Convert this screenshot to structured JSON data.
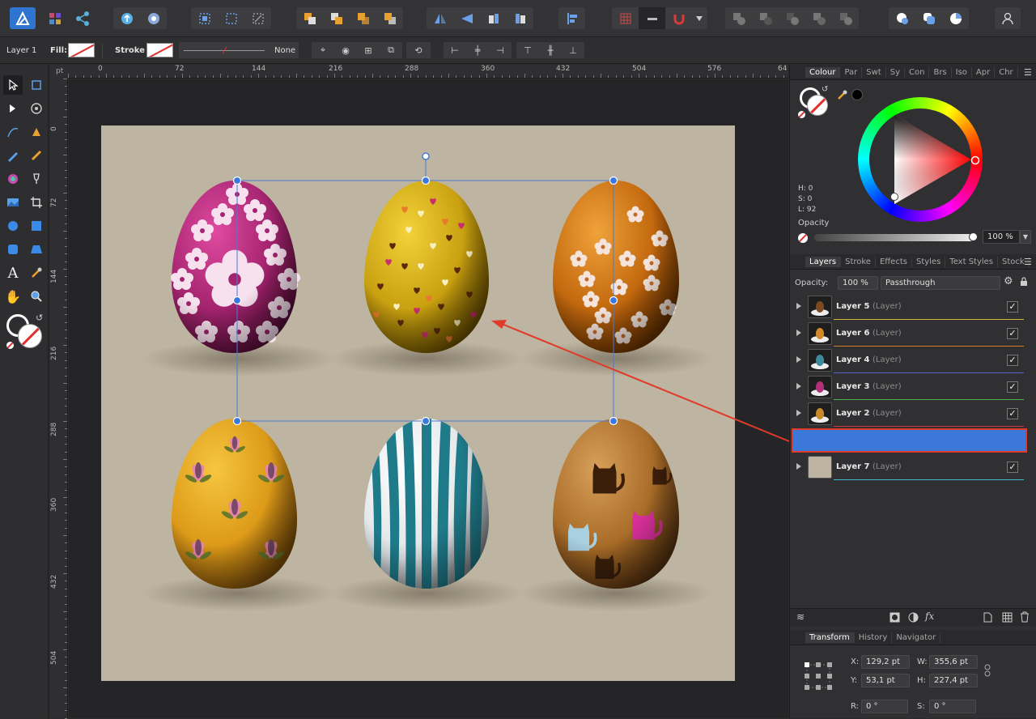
{
  "context_bar": {
    "layer_label": "Layer 1",
    "fill_label": "Fill:",
    "stroke_label": "Stroke",
    "stroke_value": "None"
  },
  "rulers": {
    "unit": "pt",
    "h_ticks": [
      "0",
      "72",
      "144",
      "216",
      "288",
      "360",
      "432",
      "504",
      "576",
      "64"
    ],
    "v_ticks": [
      "0",
      "72",
      "144",
      "216",
      "288",
      "360",
      "432",
      "504"
    ]
  },
  "colour_panel": {
    "tabs": [
      "Colour",
      "Par",
      "Swt",
      "Sy",
      "Con",
      "Brs",
      "Iso",
      "Apr",
      "Chr"
    ],
    "h": "H: 0",
    "s": "S: 0",
    "l": "L: 92",
    "opacity_label": "Opacity",
    "opacity_value": "100 %"
  },
  "layers_panel": {
    "tabs": [
      "Layers",
      "Stroke",
      "Effects",
      "Styles",
      "Text Styles",
      "Stock"
    ],
    "opacity_label": "Opacity:",
    "opacity_value": "100 %",
    "blend_mode": "Passthrough",
    "layers": [
      {
        "name": "Layer 5",
        "kind": "(Layer)",
        "line": "#d6b640",
        "egg": "#7a4a22"
      },
      {
        "name": "Layer 6",
        "kind": "(Layer)",
        "line": "#d07a2c",
        "egg": "#d08a2a"
      },
      {
        "name": "Layer 4",
        "kind": "(Layer)",
        "line": "#5a64c8",
        "egg": "#3e8a9a"
      },
      {
        "name": "Layer 3",
        "kind": "(Layer)",
        "line": "#4ab04a",
        "egg": "#b0307a"
      },
      {
        "name": "Layer 2",
        "kind": "(Layer)",
        "line": "#c83a3a",
        "egg": "#c88a2a"
      },
      {
        "name": "Layer 7",
        "kind": "(Layer)",
        "line": "#40b8c8",
        "egg": "#bdb5a2"
      }
    ]
  },
  "transform_panel": {
    "tabs": [
      "Transform",
      "History",
      "Navigator"
    ],
    "x_label": "X:",
    "x_value": "129,2 pt",
    "w_label": "W:",
    "w_value": "355,6 pt",
    "y_label": "Y:",
    "y_value": "53,1 pt",
    "h_label": "H:",
    "h_value": "227,4 pt",
    "r_label": "R:",
    "r_value": "0 °",
    "s_label": "S:",
    "s_value": "0 °"
  },
  "tools_panel": {
    "text_tool_glyph": "A"
  },
  "colors": {
    "accent_blue": "#3b78d8",
    "document_bg": "#bdb5a2",
    "highlight_red": "#e03a2a"
  }
}
